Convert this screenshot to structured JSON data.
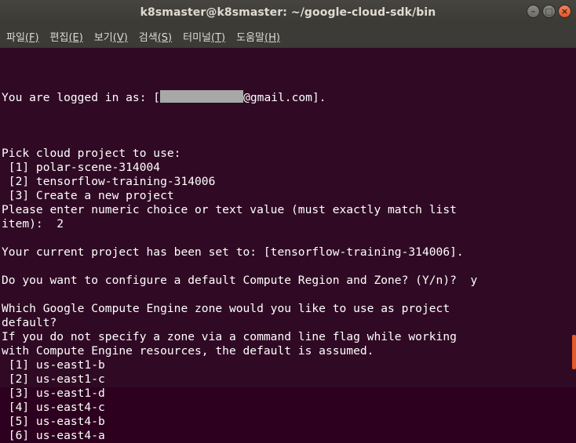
{
  "window": {
    "title": "k8smaster@k8smaster: ~/google-cloud-sdk/bin",
    "buttons": {
      "minimize": "–",
      "maximize": "□",
      "close": "×"
    }
  },
  "menu": [
    {
      "label": "파일",
      "key": "(F)",
      "name": "menu-file"
    },
    {
      "label": "편집",
      "key": "(E)",
      "name": "menu-edit"
    },
    {
      "label": "보기",
      "key": "(V)",
      "name": "menu-view"
    },
    {
      "label": "검색",
      "key": "(S)",
      "name": "menu-search"
    },
    {
      "label": "터미널",
      "key": "(T)",
      "name": "menu-terminal"
    },
    {
      "label": "도움말",
      "key": "(H)",
      "name": "menu-help"
    }
  ],
  "terminal": {
    "login_prefix": "You are logged in as: [",
    "login_suffix": "@gmail.com].",
    "lines": [
      "",
      "Pick cloud project to use:",
      " [1] polar-scene-314004",
      " [2] tensorflow-training-314006",
      " [3] Create a new project",
      "Please enter numeric choice or text value (must exactly match list",
      "item):  2",
      "",
      "Your current project has been set to: [tensorflow-training-314006].",
      "",
      "Do you want to configure a default Compute Region and Zone? (Y/n)?  y",
      "",
      "Which Google Compute Engine zone would you like to use as project",
      "default?",
      "If you do not specify a zone via a command line flag while working",
      "with Compute Engine resources, the default is assumed.",
      " [1] us-east1-b",
      " [2] us-east1-c",
      " [3] us-east1-d",
      " [4] us-east4-c",
      " [5] us-east4-b",
      " [6] us-east4-a"
    ]
  }
}
